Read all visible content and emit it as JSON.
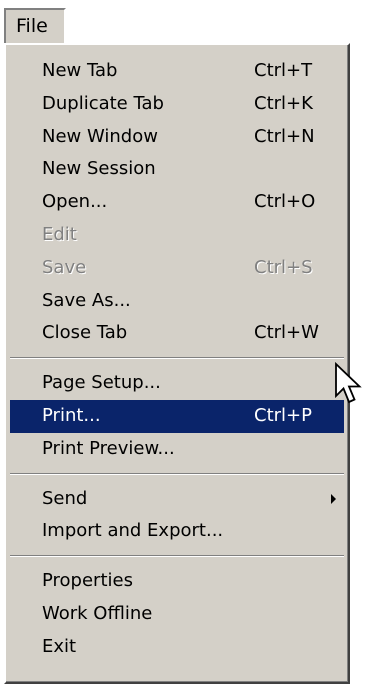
{
  "menubar": {
    "file_label": "File"
  },
  "menu": {
    "items": [
      {
        "label": "New Tab",
        "shortcut": "Ctrl+T",
        "enabled": true
      },
      {
        "label": "Duplicate Tab",
        "shortcut": "Ctrl+K",
        "enabled": true
      },
      {
        "label": "New Window",
        "shortcut": "Ctrl+N",
        "enabled": true
      },
      {
        "label": "New Session",
        "shortcut": "",
        "enabled": true
      },
      {
        "label": "Open...",
        "shortcut": "Ctrl+O",
        "enabled": true
      },
      {
        "label": "Edit",
        "shortcut": "",
        "enabled": false
      },
      {
        "label": "Save",
        "shortcut": "Ctrl+S",
        "enabled": false
      },
      {
        "label": "Save As...",
        "shortcut": "",
        "enabled": true
      },
      {
        "label": "Close Tab",
        "shortcut": "Ctrl+W",
        "enabled": true
      },
      {
        "label": "Page Setup...",
        "shortcut": "",
        "enabled": true
      },
      {
        "label": "Print...",
        "shortcut": "Ctrl+P",
        "enabled": true,
        "highlighted": true
      },
      {
        "label": "Print Preview...",
        "shortcut": "",
        "enabled": true
      },
      {
        "label": "Send",
        "shortcut": "",
        "enabled": true,
        "has_submenu": true
      },
      {
        "label": "Import and Export...",
        "shortcut": "",
        "enabled": true
      },
      {
        "label": "Properties",
        "shortcut": "",
        "enabled": true
      },
      {
        "label": "Work Offline",
        "shortcut": "",
        "enabled": true
      },
      {
        "label": "Exit",
        "shortcut": "",
        "enabled": true
      }
    ]
  },
  "colors": {
    "menu_background": "#d4d0c8",
    "highlight_background": "#0a246a",
    "highlight_text": "#ffffff",
    "disabled_text": "#808080"
  },
  "icons": {
    "submenu": "submenu-arrow-icon",
    "pointer": "mouse-pointer-icon"
  }
}
